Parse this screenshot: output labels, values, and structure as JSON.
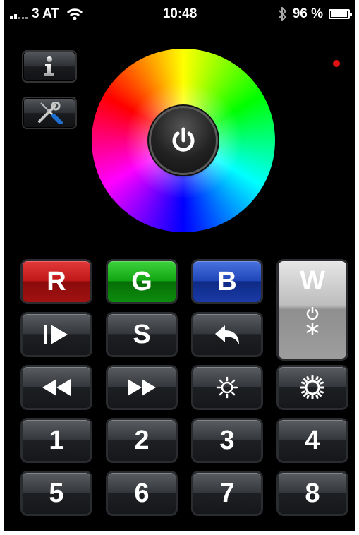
{
  "status_bar": {
    "carrier": "3 AT",
    "time": "10:48",
    "battery_percent": "96 %",
    "battery_level": 0.96,
    "icons": [
      "signal-bars-icon",
      "wifi-icon",
      "bluetooth-icon",
      "battery-icon"
    ]
  },
  "tools": {
    "info_icon": "info-icon",
    "settings_icon": "tools-wrench-screwdriver-icon"
  },
  "indicator_color": "#e21010",
  "wheel": {
    "power_icon": "power-icon"
  },
  "buttons": {
    "r": "R",
    "g": "G",
    "b": "B",
    "w": "W",
    "s": "S",
    "n1": "1",
    "n2": "2",
    "n3": "3",
    "n4": "4",
    "n5": "5",
    "n6": "6",
    "n7": "7",
    "n8": "8"
  },
  "colors": {
    "red": "#c01818",
    "green": "#13a613",
    "blue": "#2046b8",
    "white": "#bdbdbd"
  }
}
